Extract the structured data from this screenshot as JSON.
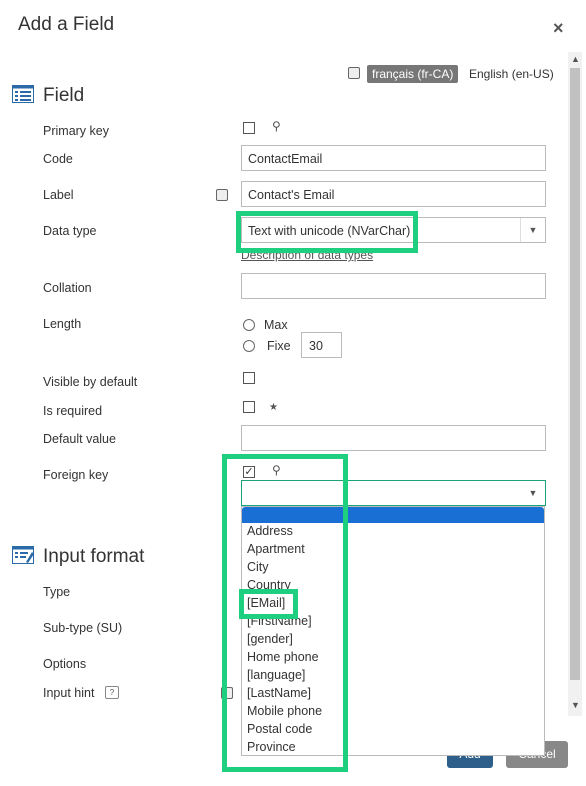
{
  "dialog": {
    "title": "Add a Field",
    "close_symbol": "×"
  },
  "languages": {
    "active": "français (fr-CA)",
    "other": "English (en-US)"
  },
  "sections": {
    "field": "Field",
    "input_format": "Input format"
  },
  "labels": {
    "primary_key": "Primary key",
    "code": "Code",
    "label": "Label",
    "data_type": "Data type",
    "collation": "Collation",
    "length": "Length",
    "visible_by_default": "Visible by default",
    "is_required": "Is required",
    "default_value": "Default value",
    "foreign_key": "Foreign key",
    "type": "Type",
    "sub_type": "Sub-type (SU)",
    "options": "Options",
    "input_hint": "Input hint"
  },
  "values": {
    "code": "ContactEmail",
    "label": "Contact's Email",
    "data_type": "Text with unicode (NVarChar)",
    "data_type_link": "Description of data types",
    "length_max": "Max",
    "length_fixe": "Fixe",
    "length_value": "30",
    "foreign_key_value": ""
  },
  "foreign_key_options": [
    "Address",
    "Apartment",
    "City",
    "Country",
    "[EMail]",
    "[FirstName]",
    "[gender]",
    "Home phone",
    "[language]",
    "[LastName]",
    "Mobile phone",
    "Postal code",
    "Province"
  ],
  "buttons": {
    "add": "Add",
    "cancel": "Cancel"
  },
  "colors": {
    "highlight": "#1fcf80",
    "dropdown_selected": "#1a6fd4",
    "button_primary": "#2d5f8a",
    "button_secondary": "#888888"
  },
  "icons": [
    "list-icon",
    "edit-list-icon",
    "key-icon",
    "star-icon",
    "help-icon",
    "language-icon",
    "close-icon",
    "chevron-down-icon"
  ]
}
